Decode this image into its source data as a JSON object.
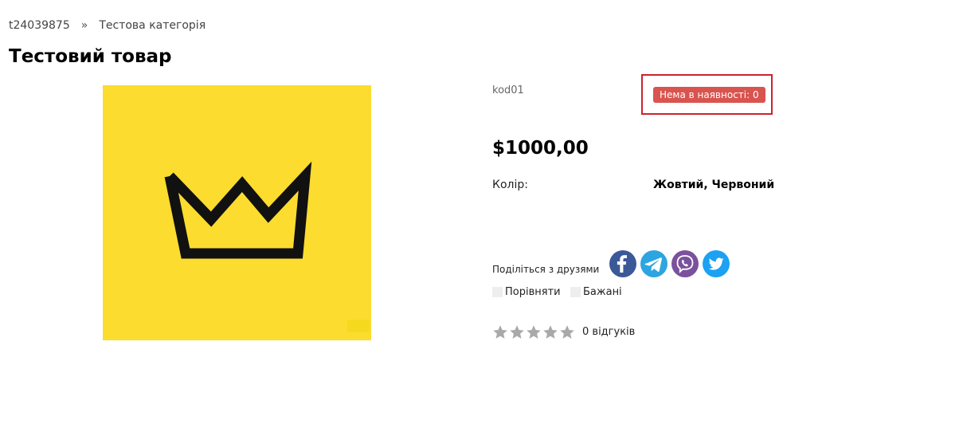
{
  "breadcrumb": {
    "items": [
      {
        "label": "t24039875"
      },
      {
        "label": "Тестова категорія"
      }
    ],
    "separator": "»"
  },
  "product": {
    "title": "Тестовий товар",
    "sku": "kod01",
    "stock_badge": "Нема в наявності: 0",
    "stock_badge_color": "#d9534f",
    "highlight_color": "#c9252d",
    "price": "$1000,00",
    "image_background": "#fbdc2f",
    "image_icon": "crown-icon",
    "attributes": [
      {
        "label": "Колір:",
        "value": "Жовтий, Червоний"
      }
    ]
  },
  "share": {
    "label": "Поділіться з друзями",
    "networks": [
      {
        "name": "facebook-icon",
        "color": "#3b5998"
      },
      {
        "name": "telegram-icon",
        "color": "#2ca5e0"
      },
      {
        "name": "viber-icon",
        "color": "#7b519d"
      },
      {
        "name": "twitter-icon",
        "color": "#1da1f2"
      }
    ]
  },
  "actions": {
    "compare_label": "Порівняти",
    "wishlist_label": "Бажані"
  },
  "rating": {
    "stars_filled": 0,
    "stars_total": 5,
    "star_color": "#a9a9a9",
    "reviews_label": "0 відгуків"
  }
}
